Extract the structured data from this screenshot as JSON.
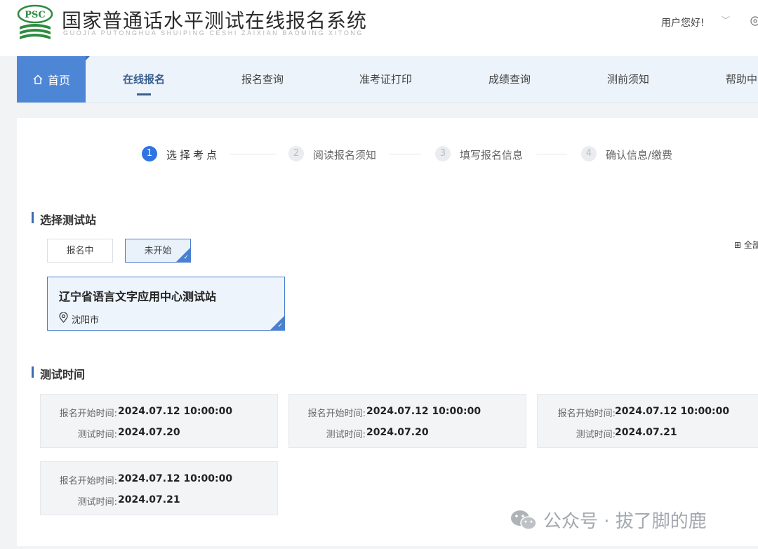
{
  "header": {
    "logo_text": "PSC",
    "title": "国家普通话水平测试在线报名系统",
    "subtitle": "GUOJIA PUTONGHUA SHUIPING CESHI ZAIXIAN BAOMING XITONG",
    "user_greeting": "用户您好!",
    "user_caret": "﹀"
  },
  "nav": {
    "home": "首页",
    "items": [
      "在线报名",
      "报名查询",
      "准考证打印",
      "成绩查询",
      "测前须知",
      "帮助中"
    ]
  },
  "steps": [
    {
      "num": "1",
      "label": "选择考点"
    },
    {
      "num": "2",
      "label": "阅读报名须知"
    },
    {
      "num": "3",
      "label": "填写报名信息"
    },
    {
      "num": "4",
      "label": "确认信息/缴费"
    }
  ],
  "station_section": {
    "title": "选择测试站",
    "tabs": [
      "报名中",
      "未开始"
    ],
    "view_all": "全部",
    "station": {
      "name": "辽宁省语言文字应用中心测试站",
      "city": "沈阳市"
    }
  },
  "time_section": {
    "title": "测试时间",
    "cards": [
      {
        "start_label": "报名开始时间:",
        "start": "2024.07.12 10:00:00",
        "test_label": "测试时间:",
        "test": "2024.07.20"
      },
      {
        "start_label": "报名开始时间:",
        "start": "2024.07.12 10:00:00",
        "test_label": "测试时间:",
        "test": "2024.07.20"
      },
      {
        "start_label": "报名开始时间:",
        "start": "2024.07.12 10:00:00",
        "test_label": "测试时间:",
        "test": "2024.07.21"
      },
      {
        "start_label": "报名开始时间:",
        "start": "2024.07.12 10:00:00",
        "test_label": "测试时间:",
        "test": "2024.07.21"
      }
    ]
  },
  "watermark": "公众号 · 拔了脚的鹿",
  "colors": {
    "primary": "#2f74e0",
    "nav_active": "#3b5f8f",
    "nav_bg": "#edf3fb",
    "home_bg": "#4e86d6",
    "logo_green": "#2e8b3e"
  }
}
